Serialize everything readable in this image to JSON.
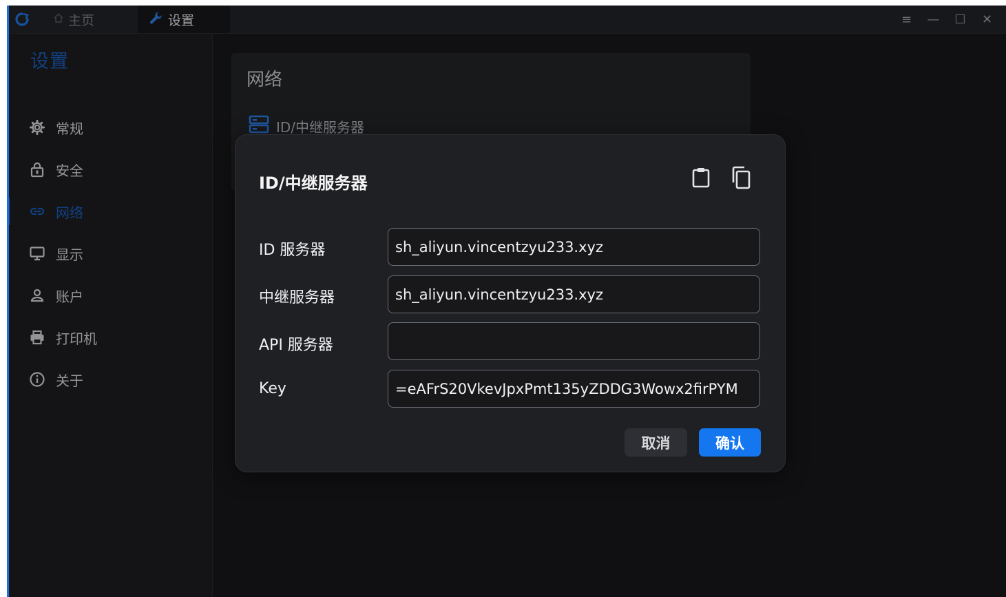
{
  "titlebar": {
    "tabs": [
      {
        "label": "主页",
        "icon": "home-icon"
      },
      {
        "label": "设置",
        "icon": "wrench-icon"
      }
    ],
    "controls": {
      "menu": "≡",
      "minimize": "—",
      "maximize": "☐",
      "close": "✕"
    }
  },
  "sidebar": {
    "title": "设置",
    "items": [
      {
        "label": "常规",
        "icon": "gear-icon"
      },
      {
        "label": "安全",
        "icon": "lock-icon"
      },
      {
        "label": "网络",
        "icon": "link-icon",
        "active": true
      },
      {
        "label": "显示",
        "icon": "monitor-icon"
      },
      {
        "label": "账户",
        "icon": "user-icon"
      },
      {
        "label": "打印机",
        "icon": "printer-icon"
      },
      {
        "label": "关于",
        "icon": "info-icon"
      }
    ]
  },
  "main": {
    "section_title": "网络",
    "item_label": "ID/中继服务器"
  },
  "dialog": {
    "title": "ID/中继服务器",
    "fields": {
      "id_server": {
        "label": "ID 服务器",
        "value": "sh_aliyun.vincentzyu233.xyz"
      },
      "relay_server": {
        "label": "中继服务器",
        "value": "sh_aliyun.vincentzyu233.xyz"
      },
      "api_server": {
        "label": "API 服务器",
        "value": ""
      },
      "key": {
        "label": "Key",
        "value": "eAFrS20VkevJpxPmt135yZDDG3Wowx2firPYM="
      }
    },
    "cancel_label": "取消",
    "ok_label": "确认"
  },
  "colors": {
    "accent": "#1477f0",
    "sidebar_active": "#1a5bb5",
    "background": "#18181b"
  }
}
